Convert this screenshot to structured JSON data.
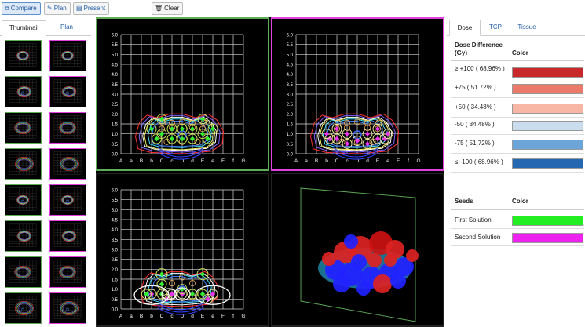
{
  "toolbar": {
    "compare_label": "Compare",
    "plan_label": "Plan",
    "present_label": "Present",
    "clear_label": "Clear"
  },
  "sidebar": {
    "tabs": [
      {
        "label": "Thumbnail",
        "active": true
      },
      {
        "label": "Plan",
        "active": false
      }
    ]
  },
  "grid": {
    "y_labels": [
      "6.0",
      "5.5",
      "5.0",
      "4.5",
      "4.0",
      "3.5",
      "3.0",
      "2.5",
      "2.0",
      "1.5",
      "1.0",
      "0.5",
      "0.0"
    ],
    "x_labels": [
      "A",
      "a",
      "B",
      "b",
      "C",
      "c",
      "D",
      "d",
      "E",
      "e",
      "F",
      "f",
      "G"
    ]
  },
  "right_panel": {
    "tabs": [
      {
        "label": "Dose",
        "active": true
      },
      {
        "label": "TCP",
        "active": false
      },
      {
        "label": "Tissue",
        "active": false
      }
    ],
    "dose_header": "Dose Difference (Gy)",
    "color_header": "Color",
    "dose_rows": [
      {
        "label": "≥ +100 ( 68.96% )",
        "color": "#c8282a"
      },
      {
        "label": "+75 ( 51.72% )",
        "color": "#ec7a6a"
      },
      {
        "label": "+50 ( 34.48% )",
        "color": "#f7b7a4"
      },
      {
        "label": "-50 ( 34.48% )",
        "color": "#c9ddef"
      },
      {
        "label": "-75 ( 51.72% )",
        "color": "#6ea5d8"
      },
      {
        "label": "≤ -100 ( 68.96% )",
        "color": "#2667b2"
      }
    ],
    "seeds_header": "Seeds",
    "seeds_color_header": "Color",
    "seed_rows": [
      {
        "label": "First Solution",
        "color": "#22ee22"
      },
      {
        "label": "Second Solution",
        "color": "#ee22ee"
      }
    ]
  },
  "colors": {
    "first_solution": "#5fae57",
    "second_solution": "#e040e0",
    "accent": "#245ea8"
  }
}
